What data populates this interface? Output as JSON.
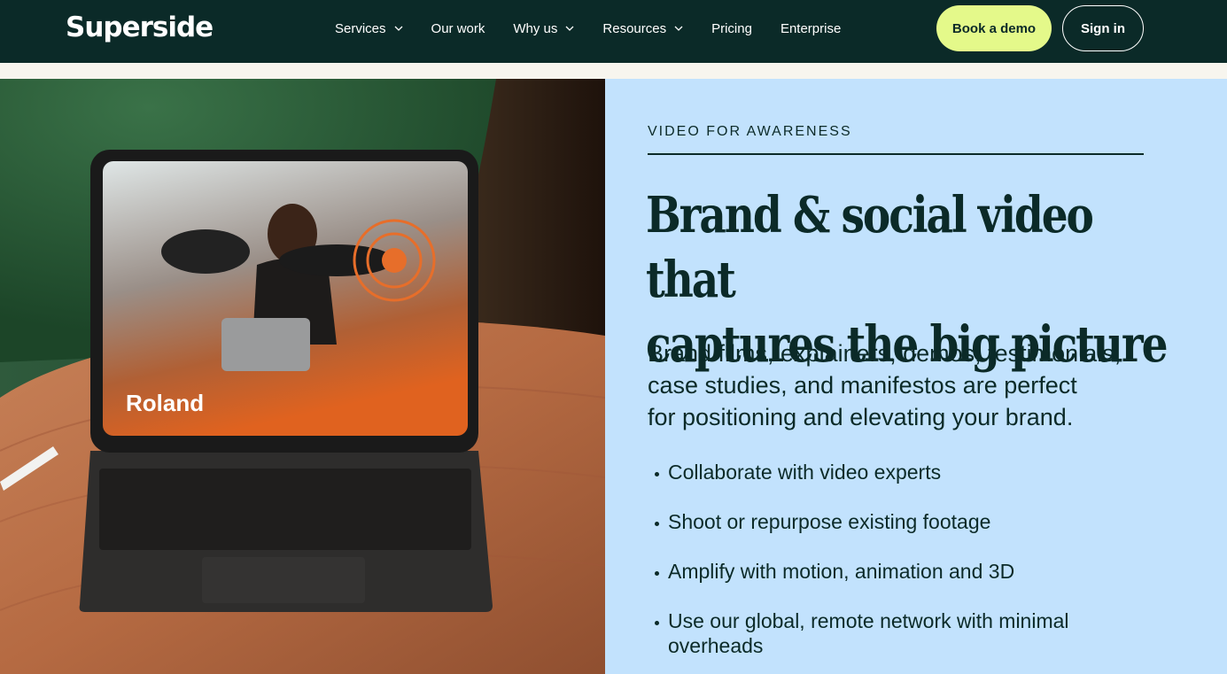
{
  "nav": {
    "logo": "Superside",
    "items": [
      {
        "label": "Services",
        "dropdown": true
      },
      {
        "label": "Our work",
        "dropdown": false
      },
      {
        "label": "Why us",
        "dropdown": true
      },
      {
        "label": "Resources",
        "dropdown": true
      },
      {
        "label": "Pricing",
        "dropdown": false
      },
      {
        "label": "Enterprise",
        "dropdown": false
      }
    ],
    "book_demo": "Book a demo",
    "sign_in": "Sign in"
  },
  "hero": {
    "image_brand_text": "Roland",
    "eyebrow": "VIDEO FOR AWARENESS",
    "headline_line1": "Brand & social video that",
    "headline_line2": "captures the big picture",
    "lead_line1": "Brand films, explainers, demos, testimonials,",
    "lead_line2": "case studies, and manifestos are perfect",
    "lead_line3": "for positioning and elevating your brand.",
    "bullets": [
      "Collaborate with video experts",
      "Shoot or repurpose existing footage",
      "Amplify with motion, animation and 3D",
      "Use our global, remote network with minimal overheads"
    ]
  },
  "colors": {
    "nav_bg": "#0b2a28",
    "accent": "#e4f98a",
    "panel_bg": "#c2e2fd"
  }
}
